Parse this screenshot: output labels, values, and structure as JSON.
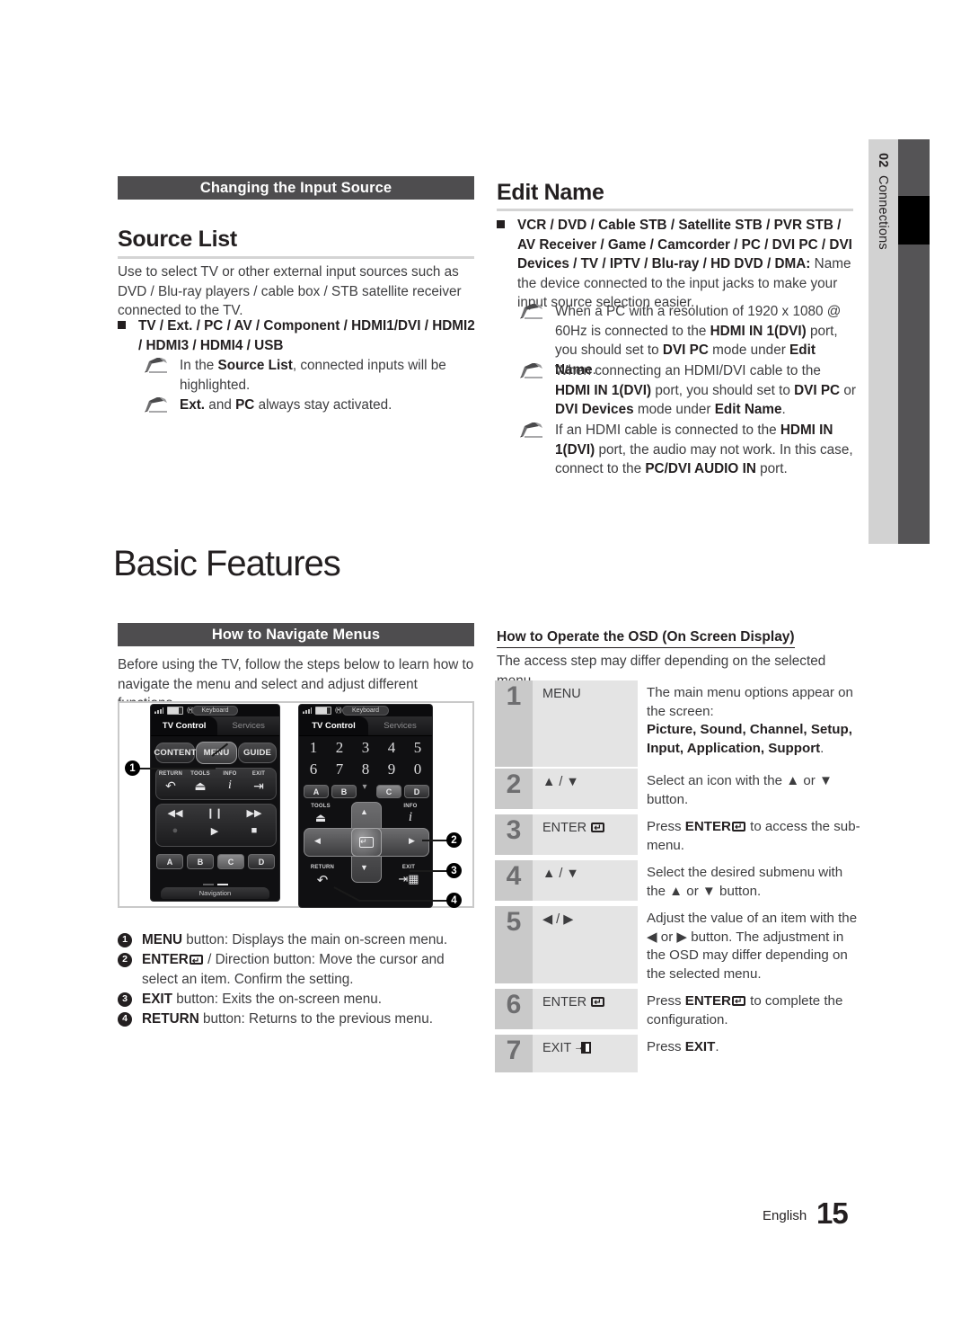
{
  "side_tab": {
    "number": "02",
    "label": "Connections"
  },
  "left_column": {
    "section_bar": "Changing the Input Source",
    "heading": "Source List",
    "intro": "Use to select TV or other external input sources such as DVD / Blu-ray players / cable box / STB satellite receiver connected to the TV.",
    "bullet": "TV / Ext. / PC / AV / Component / HDMI1/DVI / HDMI2 / HDMI3 / HDMI4 / USB",
    "notes": [
      "In the Source List, connected inputs will be highlighted.",
      "Ext. and PC always stay activated."
    ]
  },
  "right_column": {
    "heading": "Edit Name",
    "bullet": "VCR / DVD / Cable STB / Satellite STB / PVR STB / AV Receiver / Game / Camcorder / PC / DVI PC / DVI Devices / TV / IPTV / Blu-ray / HD DVD / DMA:",
    "bullet_tail": "Name the device connected to the input jacks to make your input source selection easier.",
    "notes": [
      "When a PC with a resolution of 1920 x 1080 @ 60Hz is connected to the HDMI IN 1(DVI) port, you should set to DVI PC mode under Edit Name.",
      "When connecting an HDMI/DVI cable to the HDMI IN 1(DVI) port, you should set to DVI PC or DVI Devices mode under Edit Name.",
      "If an HDMI cable is connected to the HDMI IN 1(DVI) port, the audio may not work. In this case, connect to the PC/DVI AUDIO IN port."
    ]
  },
  "chapter": {
    "title": "Basic Features"
  },
  "navigate": {
    "section_bar": "How to Navigate Menus",
    "intro": "Before using the TV, follow the steps below to learn how to navigate the menu and select and adjust different functions.",
    "legend": [
      {
        "num": "1",
        "bold": "MENU",
        "rest": " button: Displays the main on-screen menu."
      },
      {
        "num": "2",
        "bold": "ENTER",
        "rest": " / Direction button: Move the cursor and select an item. Confirm the setting."
      },
      {
        "num": "3",
        "bold": "EXIT",
        "rest": " button: Exits the on-screen menu."
      },
      {
        "num": "4",
        "bold": "RETURN",
        "rest": " button: Returns to the previous menu."
      }
    ]
  },
  "remote_left": {
    "status_keyboard": "Keyboard",
    "tab_active": "TV Control",
    "tab_inactive": "Services",
    "top_buttons": [
      "CONTENT",
      "MENU",
      "GUIDE"
    ],
    "fn_labels": [
      "RETURN",
      "TOOLS",
      "INFO",
      "EXIT"
    ],
    "fn_icons": [
      "↶",
      "⏏",
      "i",
      "⇥"
    ],
    "transport_row1": [
      "◀◀",
      "❙❙",
      "▶▶"
    ],
    "transport_row2": [
      "●",
      "▶",
      "■"
    ],
    "color_buttons": [
      "A",
      "B",
      "C",
      "D"
    ],
    "nav_label": "Navigation"
  },
  "remote_right": {
    "status_keyboard": "Keyboard",
    "tab_active": "TV Control",
    "tab_inactive": "Services",
    "numbers_row1": [
      "1",
      "2",
      "3",
      "4",
      "5"
    ],
    "numbers_row2": [
      "6",
      "7",
      "8",
      "9",
      "0"
    ],
    "color_buttons": [
      "A",
      "B",
      "C",
      "D"
    ],
    "tools_label": "TOOLS",
    "info_label": "INFO",
    "return_label": "RETURN",
    "exit_label": "EXIT",
    "dpad": {
      "up": "▲",
      "down": "▼",
      "left": "◀",
      "right": "▶",
      "center": "↵"
    }
  },
  "callouts": [
    "1",
    "2",
    "3",
    "4"
  ],
  "osd": {
    "sub_heading": "How to Operate the OSD (On Screen Display)",
    "intro": "The access step may differ depending on the selected menu.",
    "rows": [
      {
        "num": "1",
        "key": "MENU",
        "key_icon": "",
        "desc_plain": "The main menu options appear on the screen:",
        "desc_bold": "Picture, Sound, Channel, Setup, Input, Application, Support",
        "desc_tail": "."
      },
      {
        "num": "2",
        "key": "▲ / ▼",
        "key_icon": "",
        "desc_plain": "Select an icon with the ▲ or ▼ button.",
        "desc_bold": "",
        "desc_tail": ""
      },
      {
        "num": "3",
        "key": "ENTER",
        "key_icon": "enter-icon",
        "desc_plain": "Press ENTER",
        "desc_bold": "",
        "desc_tail": " to access the sub-menu.",
        "desc_icon": "enter-icon"
      },
      {
        "num": "4",
        "key": "▲ / ▼",
        "key_icon": "",
        "desc_plain": "Select the desired submenu with the ▲ or ▼ button.",
        "desc_bold": "",
        "desc_tail": ""
      },
      {
        "num": "5",
        "key": "◀ / ▶",
        "key_icon": "",
        "desc_plain": "Adjust the value of an item with the ◀ or ▶ button. The adjustment in the OSD may differ depending on the selected menu.",
        "desc_bold": "",
        "desc_tail": ""
      },
      {
        "num": "6",
        "key": "ENTER",
        "key_icon": "enter-icon",
        "desc_plain": "Press ENTER",
        "desc_bold": "",
        "desc_tail": " to complete the configuration.",
        "desc_icon": "enter-icon"
      },
      {
        "num": "7",
        "key": "EXIT",
        "key_icon": "exit-icon",
        "desc_plain": "Press EXIT.",
        "desc_bold": "",
        "desc_tail": ""
      }
    ]
  },
  "footer": {
    "language": "English",
    "page": "15"
  },
  "colors": {
    "bar_dark": "#4e4d4f",
    "side_tab_light": "#d2d2d2",
    "side_bar_dark": "#555456",
    "osd_num_bg": "#c9c9c9",
    "osd_key_bg": "#e4e4e4",
    "rule": "#d4d4d4"
  }
}
